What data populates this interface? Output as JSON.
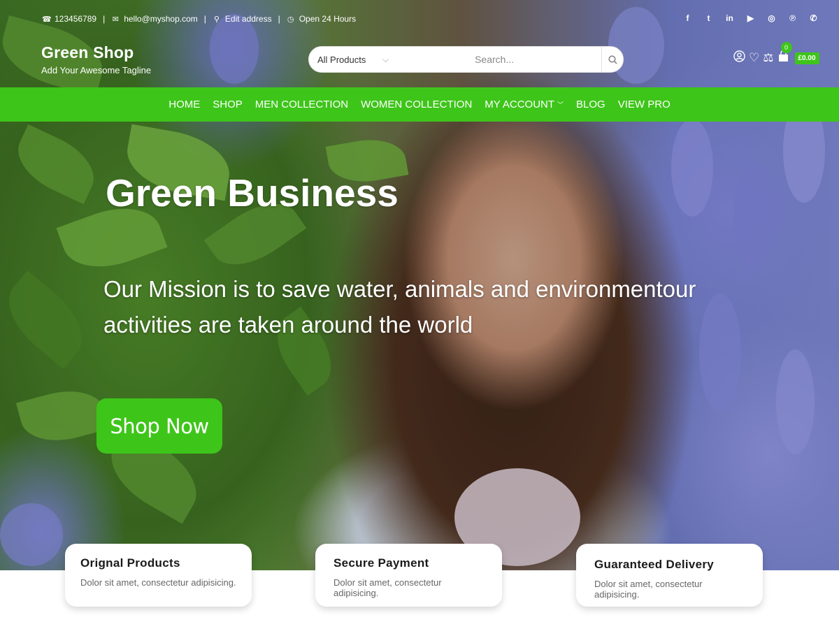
{
  "topbar": {
    "phone": "123456789",
    "email": "hello@myshop.com",
    "address": "Edit address",
    "hours": "Open 24 Hours",
    "social_icons": [
      "facebook-icon",
      "twitter-icon",
      "linkedin-icon",
      "youtube-icon",
      "instagram-icon",
      "pinterest-icon",
      "whatsapp-icon"
    ]
  },
  "brand": {
    "title": "Green Shop",
    "tagline": "Add Your Awesome Tagline"
  },
  "search": {
    "category": "All Products",
    "placeholder": "Search..."
  },
  "cart": {
    "count": "0",
    "total": "£0.00"
  },
  "nav": {
    "items": [
      {
        "label": "Home"
      },
      {
        "label": "Shop"
      },
      {
        "label": "Men Collection"
      },
      {
        "label": "Women Collection"
      },
      {
        "label": "My Account"
      },
      {
        "label": "Blog"
      },
      {
        "label": "View Pro"
      }
    ]
  },
  "hero": {
    "title": "Green Business",
    "subtitle": "Our Mission is to save water, animals and environmentour activities are taken around the world",
    "button": "Shop Now"
  },
  "features": [
    {
      "title": "Orignal Products",
      "text": "Dolor sit amet, consectetur adipisicing."
    },
    {
      "title": "Secure Payment",
      "text": "Dolor sit amet, consectetur adipisicing."
    },
    {
      "title": "Guaranteed Delivery",
      "text": "Dolor sit amet, consectetur adipisicing."
    }
  ],
  "colors": {
    "accent": "#3ec51a",
    "text_dark": "#1a1a1a"
  }
}
